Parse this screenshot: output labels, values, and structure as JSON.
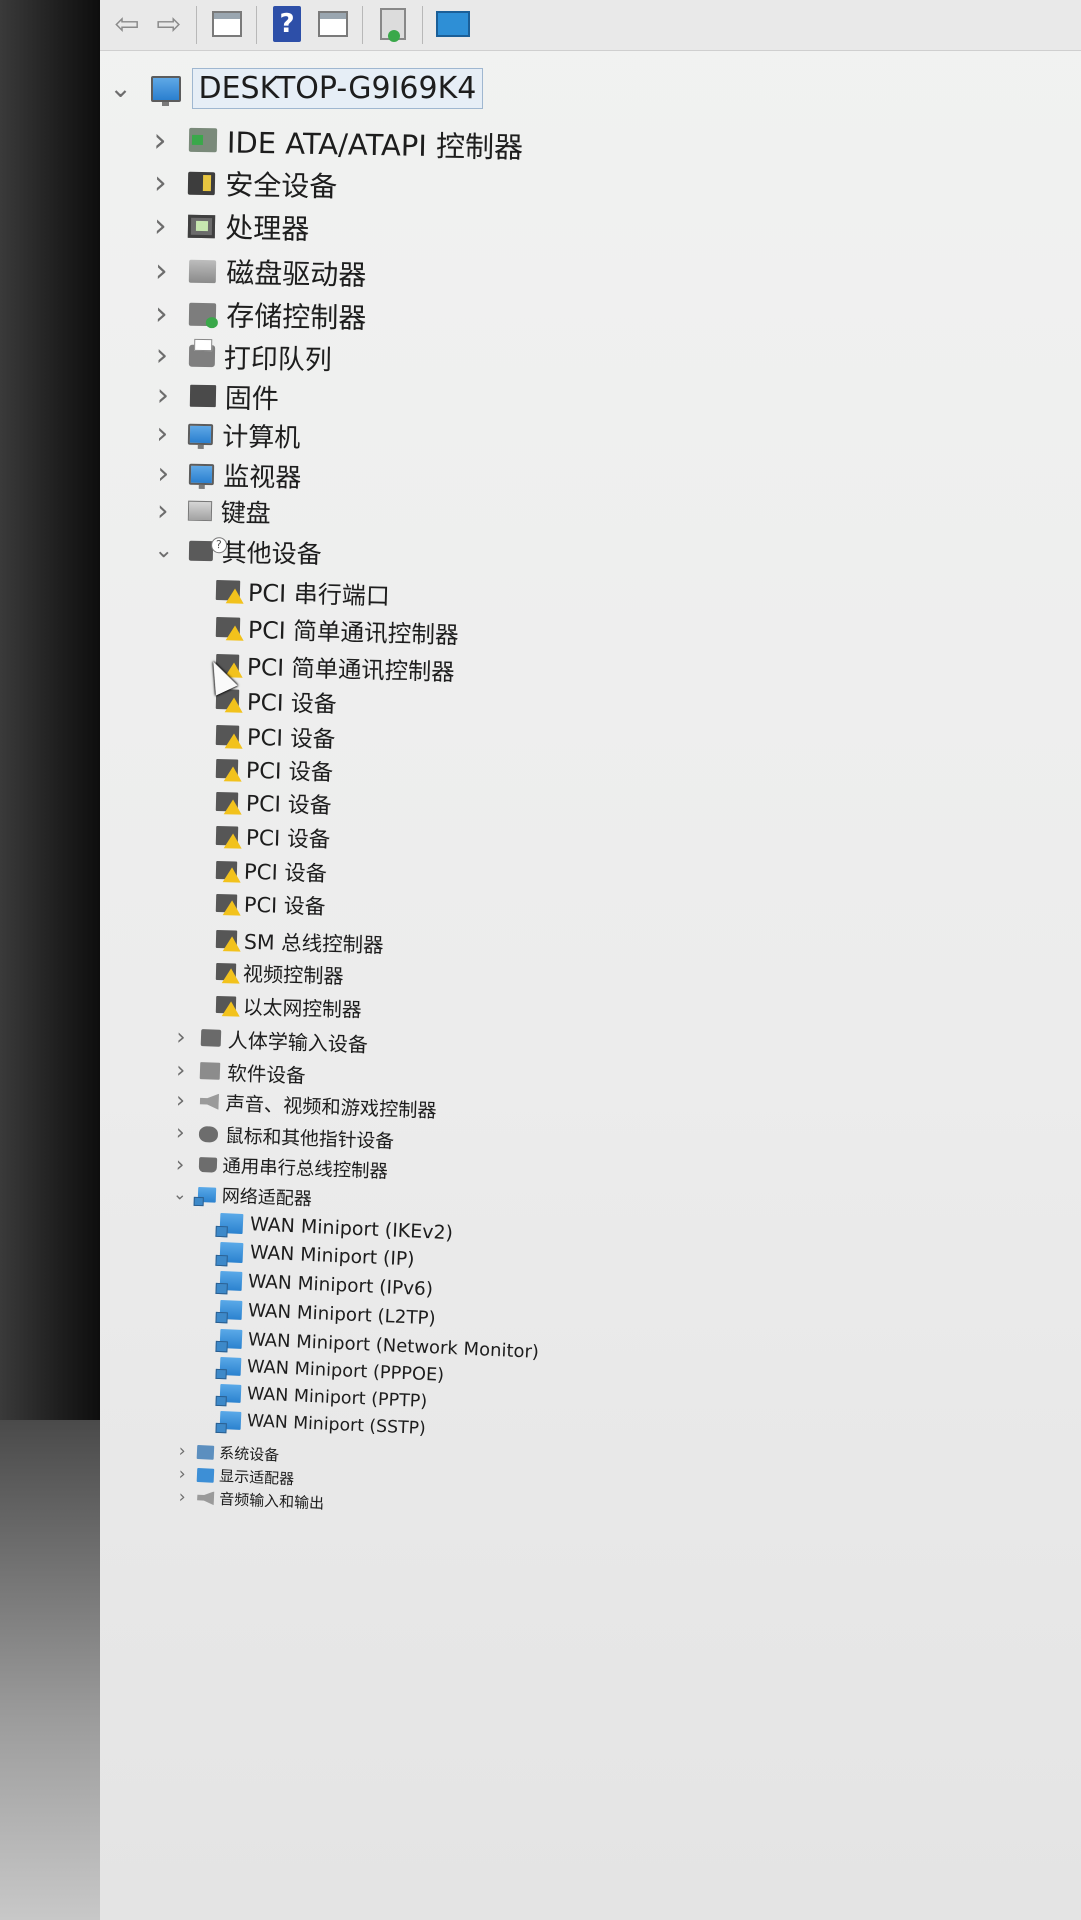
{
  "toolbar": {
    "items": [
      {
        "icon": "back-arrow-icon"
      },
      {
        "icon": "forward-arrow-icon"
      },
      {
        "icon": "properties-icon"
      },
      {
        "icon": "help-icon",
        "label": "?"
      },
      {
        "icon": "view-icon"
      },
      {
        "icon": "update-driver-icon"
      },
      {
        "icon": "monitor-scan-icon"
      }
    ]
  },
  "tree": {
    "root": {
      "label": "DESKTOP-G9I69K4",
      "expanded": true
    },
    "categories": [
      {
        "label": "IDE ATA/ATAPI 控制器",
        "icon": "ide-controller-icon"
      },
      {
        "label": "安全设备",
        "icon": "security-device-icon"
      },
      {
        "label": "处理器",
        "icon": "processor-icon"
      },
      {
        "label": "磁盘驱动器",
        "icon": "disk-drive-icon"
      },
      {
        "label": "存储控制器",
        "icon": "storage-controller-icon"
      },
      {
        "label": "打印队列",
        "icon": "printer-icon"
      },
      {
        "label": "固件",
        "icon": "firmware-icon"
      },
      {
        "label": "计算机",
        "icon": "computer-icon"
      },
      {
        "label": "监视器",
        "icon": "monitor-icon"
      },
      {
        "label": "键盘",
        "icon": "keyboard-icon"
      },
      {
        "label": "其他设备",
        "icon": "other-devices-icon",
        "expanded": true
      }
    ],
    "other_devices": [
      "PCI 串行端口",
      "PCI 简单通讯控制器",
      "PCI 简单通讯控制器",
      "PCI 设备",
      "PCI 设备",
      "PCI 设备",
      "PCI 设备",
      "PCI 设备",
      "PCI 设备",
      "PCI 设备",
      "SM 总线控制器",
      "视频控制器",
      "以太网控制器"
    ],
    "categories_mid": [
      {
        "label": "人体学输入设备",
        "icon": "hid-icon"
      },
      {
        "label": "软件设备",
        "icon": "software-device-icon"
      },
      {
        "label": "声音、视频和游戏控制器",
        "icon": "sound-icon"
      },
      {
        "label": "鼠标和其他指针设备",
        "icon": "mouse-icon"
      },
      {
        "label": "通用串行总线控制器",
        "icon": "usb-icon"
      },
      {
        "label": "网络适配器",
        "icon": "network-adapter-icon",
        "expanded": true
      }
    ],
    "network_adapters": [
      "WAN Miniport (IKEv2)",
      "WAN Miniport (IP)",
      "WAN Miniport (IPv6)",
      "WAN Miniport (L2TP)",
      "WAN Miniport (Network Monitor)",
      "WAN Miniport (PPPOE)",
      "WAN Miniport (PPTP)",
      "WAN Miniport (SSTP)"
    ],
    "categories_end": [
      {
        "label": "系统设备",
        "icon": "system-device-icon"
      },
      {
        "label": "显示适配器",
        "icon": "display-adapter-icon"
      },
      {
        "label": "音频输入和输出",
        "icon": "audio-io-icon"
      }
    ]
  }
}
